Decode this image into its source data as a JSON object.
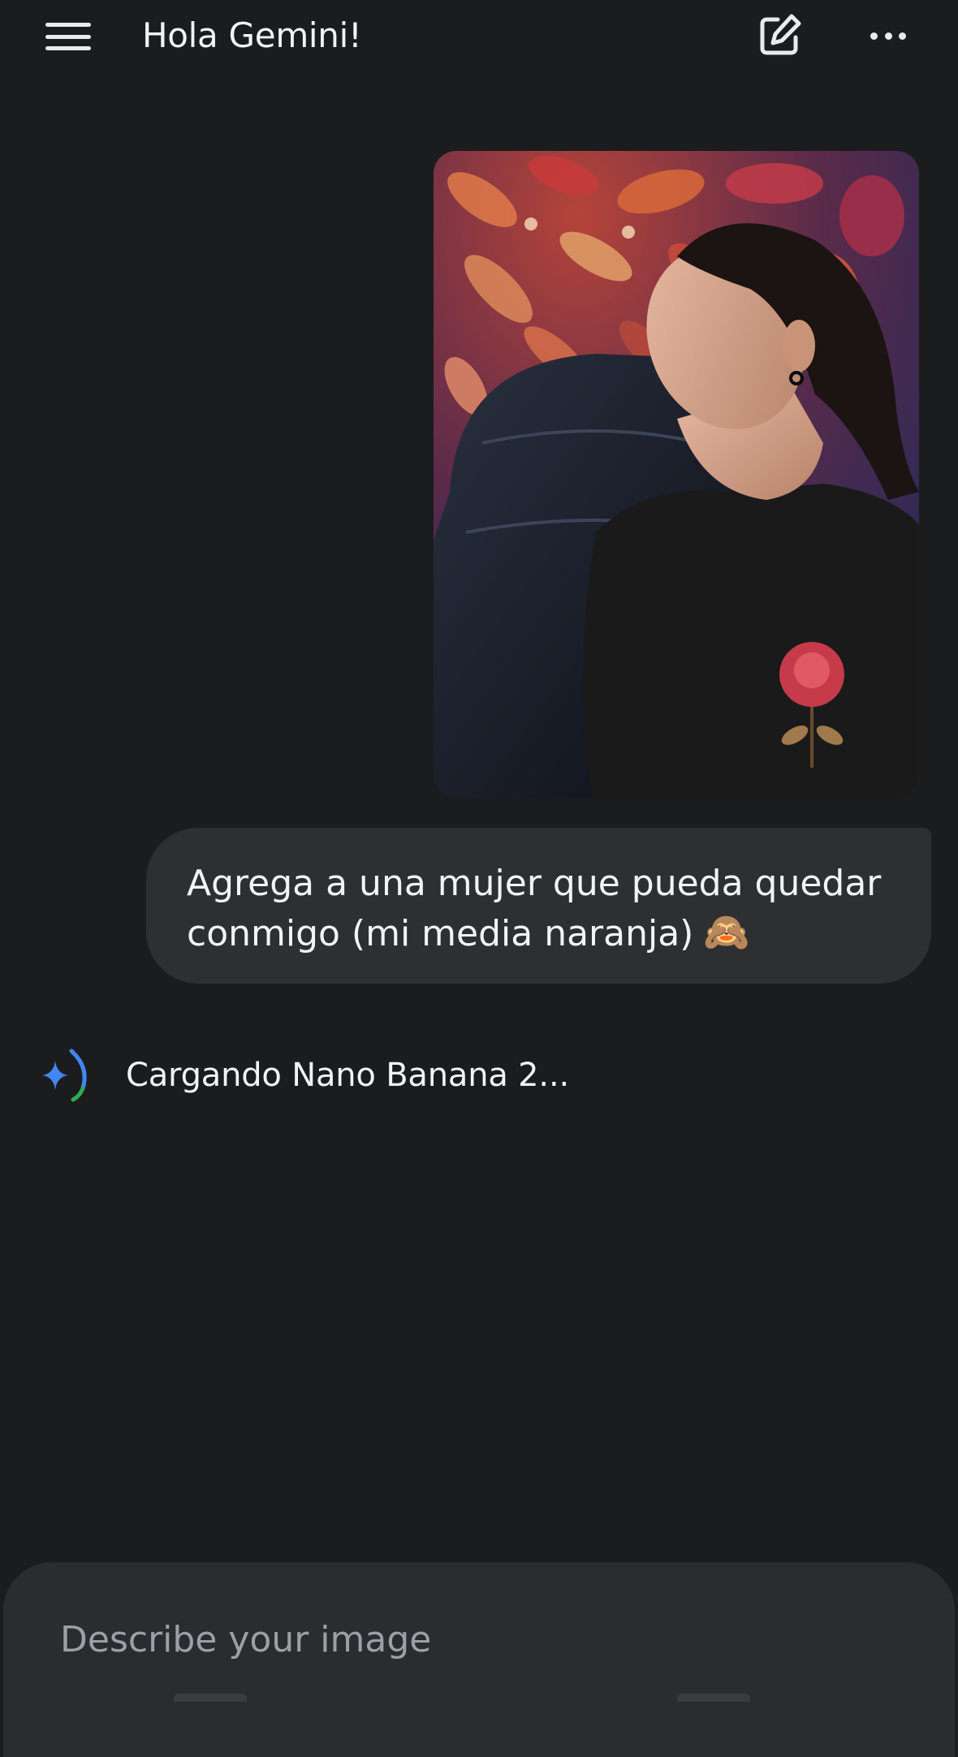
{
  "header": {
    "menu_icon": "hamburger-menu-icon",
    "title": "Hola Gemini!",
    "new_chat_icon": "edit-square-icon",
    "more_icon": "more-horizontal-icon"
  },
  "conversation": {
    "user_image_description": "uploaded photo",
    "user_message": "Agrega a una mujer que pueda quedar conmigo (mi media naranja)",
    "user_message_emoji": "🙈",
    "assistant_status": "Cargando Nano Banana 2...",
    "assistant_icon": "gemini-sparkle-icon"
  },
  "composer": {
    "placeholder": "Describe your image"
  },
  "colors": {
    "background": "#1b1c1e",
    "bubble": "#2d2f31",
    "composer": "#2a2c2f",
    "accent_blue": "#4285f4",
    "accent_green": "#34a853"
  }
}
